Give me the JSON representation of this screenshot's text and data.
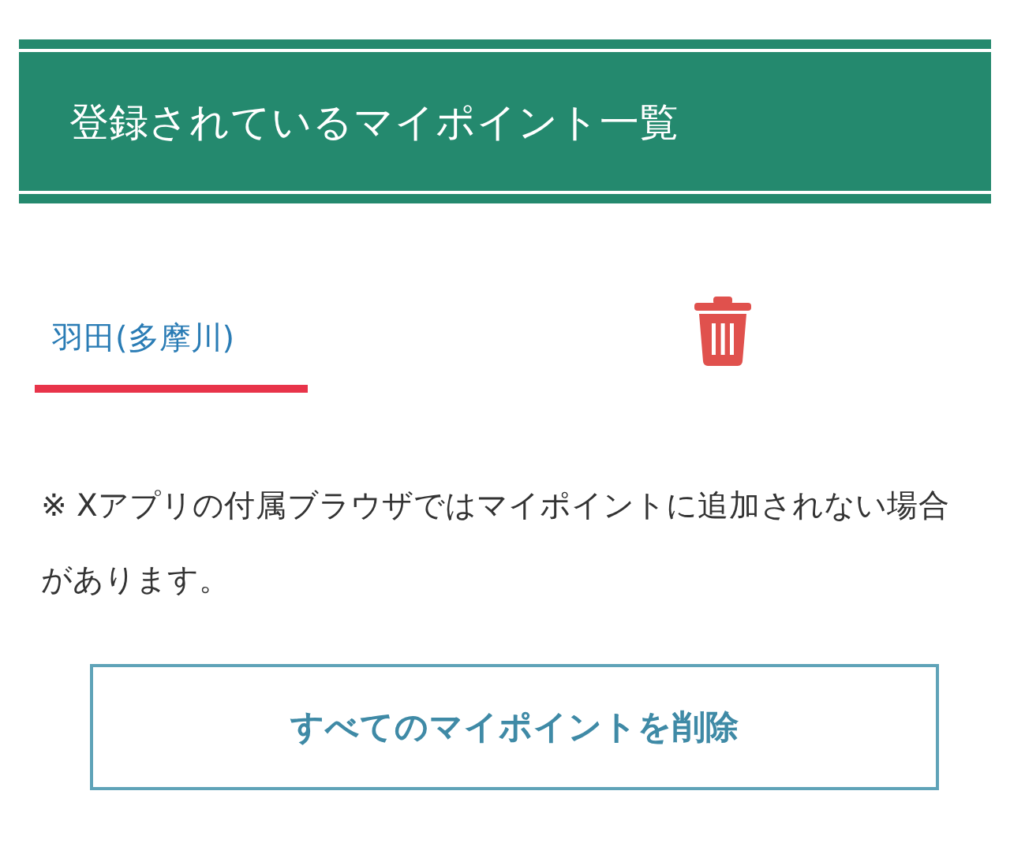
{
  "header": {
    "title": "登録されているマイポイント一覧"
  },
  "points": [
    {
      "name": "羽田(多摩川)"
    }
  ],
  "note": "※ Xアプリの付属ブラウザではマイポイントに追加されない場合があります。",
  "delete_all_button": {
    "label": "すべてのマイポイントを削除"
  }
}
